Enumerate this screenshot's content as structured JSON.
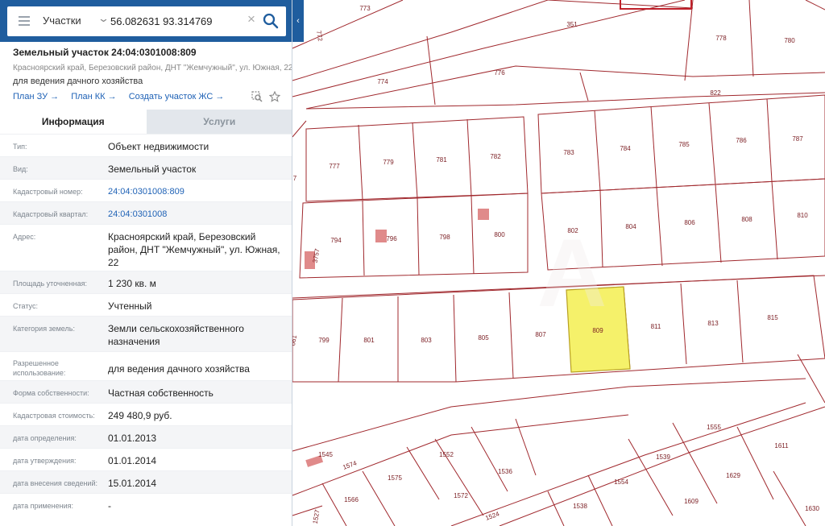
{
  "search": {
    "type_label": "Участки",
    "coords_value": "56.082631 93.314769",
    "collapse_glyph": "‹"
  },
  "object": {
    "title": "Земельный участок 24:04:0301008:809",
    "address": "Красноярский край, Березовский район, ДНТ \"Жемчужный\", ул. Южная, 22",
    "use": "для ведения дачного хозяйства",
    "links": [
      "План ЗУ →",
      "План КК →",
      "Создать участок ЖС →"
    ]
  },
  "tabs": [
    "Информация",
    "Услуги"
  ],
  "info": [
    {
      "label": "Тип:",
      "value": "Объект недвижимости"
    },
    {
      "label": "Вид:",
      "value": "Земельный участок"
    },
    {
      "label": "Кадастровый номер:",
      "value": "24:04:0301008:809",
      "link": true
    },
    {
      "label": "Кадастровый квартал:",
      "value": "24:04:0301008",
      "link": true
    },
    {
      "label": "Адрес:",
      "value": "Красноярский край, Березовский район, ДНТ \"Жемчужный\", ул. Южная, 22"
    },
    {
      "label": "Площадь уточненная:",
      "value": "1 230 кв. м"
    },
    {
      "label": "Статус:",
      "value": "Учтенный"
    },
    {
      "label": "Категория земель:",
      "value": "Земли сельскохозяйственного назначения"
    },
    {
      "label": "Разрешенное использование:",
      "value": "для ведения дачного хозяйства"
    },
    {
      "label": "Форма собственности:",
      "value": "Частная собственность"
    },
    {
      "label": "Кадастровая стоимость:",
      "value": "249 480,9 руб."
    },
    {
      "label": "дата определения:",
      "value": "01.01.2013"
    },
    {
      "label": "дата утверждения:",
      "value": "01.01.2014"
    },
    {
      "label": "дата внесения сведений:",
      "value": "15.01.2014"
    },
    {
      "label": "дата применения:",
      "value": "-"
    }
  ],
  "map": {
    "colors": {
      "border": "#a0282d",
      "selected": "#f5f16a",
      "building": "#e08a8a",
      "label": "#7a1d22"
    },
    "labels": {
      "p773": "773",
      "p351": "351",
      "p778": "778",
      "p780": "780",
      "p772": "772",
      "p774": "774",
      "p776": "776",
      "p822": "822",
      "p777": "777",
      "p779": "779",
      "p781": "781",
      "p782": "782",
      "p783": "783",
      "p784": "784",
      "p785": "785",
      "p786": "786",
      "p787": "787",
      "p794": "794",
      "p3757": "3757",
      "p796": "796",
      "p798": "798",
      "p800": "800",
      "p802": "802",
      "p804": "804",
      "p806": "806",
      "p808": "808",
      "p810": "810",
      "p799": "799",
      "p801": "801",
      "p803": "803",
      "p805": "805",
      "p807": "807",
      "p809": "809",
      "p811": "811",
      "p813": "813",
      "p815": "815",
      "p661": "661",
      "p7": "7",
      "p1555": "1555",
      "p1611": "1611",
      "p1545": "1545",
      "p1574": "1574",
      "p1552": "1552",
      "p1539": "1539",
      "p1536": "1536",
      "p1575": "1575",
      "p1629": "1629",
      "p1554": "1554",
      "p1572": "1572",
      "p1566": "1566",
      "p1609": "1609",
      "p1538": "1538",
      "p1524": "1524",
      "p1630": "1630",
      "p1527": "1527"
    }
  }
}
